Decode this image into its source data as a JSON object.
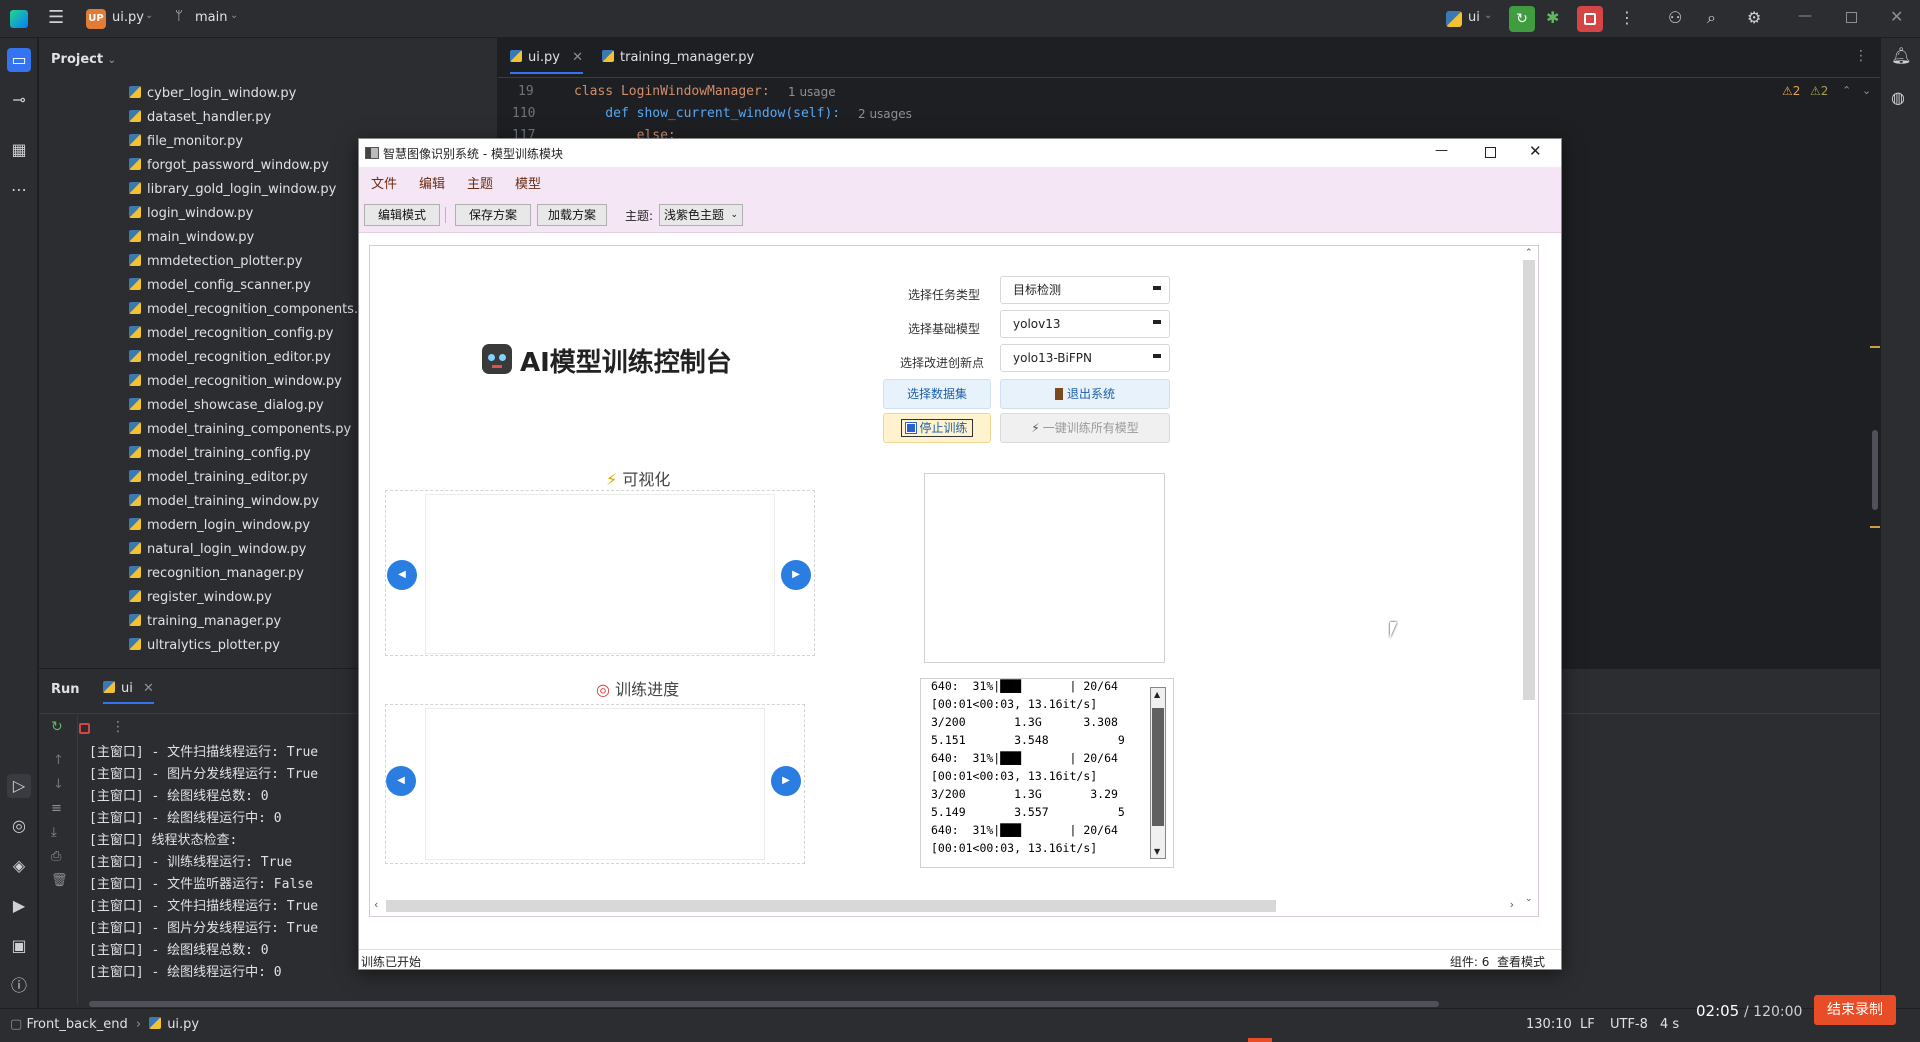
{
  "ide": {
    "project_badge": "UP",
    "project_file": "ui.py",
    "branch": "main",
    "run_config": "ui",
    "project_label": "Project",
    "tabs": [
      {
        "label": "ui.py"
      },
      {
        "label": "training_manager.py"
      }
    ],
    "files": [
      "cyber_login_window.py",
      "dataset_handler.py",
      "file_monitor.py",
      "forgot_password_window.py",
      "library_gold_login_window.py",
      "login_window.py",
      "main_window.py",
      "mmdetection_plotter.py",
      "model_config_scanner.py",
      "model_recognition_components.py",
      "model_recognition_config.py",
      "model_recognition_editor.py",
      "model_recognition_window.py",
      "model_showcase_dialog.py",
      "model_training_components.py",
      "model_training_config.py",
      "model_training_editor.py",
      "model_training_window.py",
      "modern_login_window.py",
      "natural_login_window.py",
      "recognition_manager.py",
      "register_window.py",
      "training_manager.py",
      "ultralytics_plotter.py"
    ],
    "code": [
      {
        "line": "19",
        "text": "class LoginWindowManager:",
        "hint": "1 usage"
      },
      {
        "line": "110",
        "text": "    def show_current_window(self):",
        "hint": "2 usages"
      },
      {
        "line": "117",
        "text": "        else:",
        "hint": ""
      }
    ],
    "warnings": [
      "2",
      "2"
    ],
    "run_tab": "Run",
    "run_config_tab": "ui",
    "console": [
      "[主窗口] - 文件扫描线程运行: True",
      "[主窗口] - 图片分发线程运行: True",
      "[主窗口] - 绘图线程总数: 0",
      "[主窗口] - 绘图线程运行中: 0",
      "[主窗口] 线程状态检查:",
      "[主窗口] - 训练线程运行: True",
      "[主窗口] - 文件监听器运行: False",
      "[主窗口] - 文件扫描线程运行: True",
      "[主窗口] - 图片分发线程运行: True",
      "[主窗口] - 绘图线程总数: 0",
      "[主窗口] - 绘图线程运行中: 0"
    ],
    "breadcrumb": [
      "Front_back_end",
      "ui.py"
    ],
    "status": {
      "position": "130:10",
      "line_sep": "LF",
      "encoding": "UTF-8",
      "indent": "4 s"
    },
    "recording": {
      "time": "02:05",
      "total": "/ 120:00",
      "button": "结束录制"
    }
  },
  "app": {
    "title": "智慧图像识别系统 - 模型训练模块",
    "menus": [
      "文件",
      "编辑",
      "主题",
      "模型"
    ],
    "toolbar": {
      "edit_mode": "编辑模式",
      "save_plan": "保存方案",
      "load_plan": "加载方案",
      "theme_label": "主题:",
      "theme_value": "浅紫色主题"
    },
    "heading": "AI模型训练控制台",
    "form": {
      "task_label": "选择任务类型",
      "task_value": "目标检测",
      "model_label": "选择基础模型",
      "model_value": "yolov13",
      "improve_label": "选择改进创新点",
      "improve_value": "yolo13-BiFPN"
    },
    "buttons": {
      "dataset": "选择数据集",
      "exit": "退出系统",
      "stop": "停止训练",
      "train_all": "一键训练所有模型"
    },
    "viz_title": "可视化",
    "progress_title": "训练进度",
    "terminal": [
      "640:  31%|███       | 20/64",
      "[00:01<00:03, 13.16it/s]",
      "3/200       1.3G      3.308",
      "5.151       3.548          9",
      "640:  31%|███       | 20/64",
      "[00:01<00:03, 13.16it/s]",
      "3/200       1.3G       3.29",
      "5.149       3.557          5",
      "640:  31%|███       | 20/64",
      "[00:01<00:03, 13.16it/s]"
    ],
    "status_left": "训练已开始",
    "status_right": "组件: 6  查看模式"
  }
}
